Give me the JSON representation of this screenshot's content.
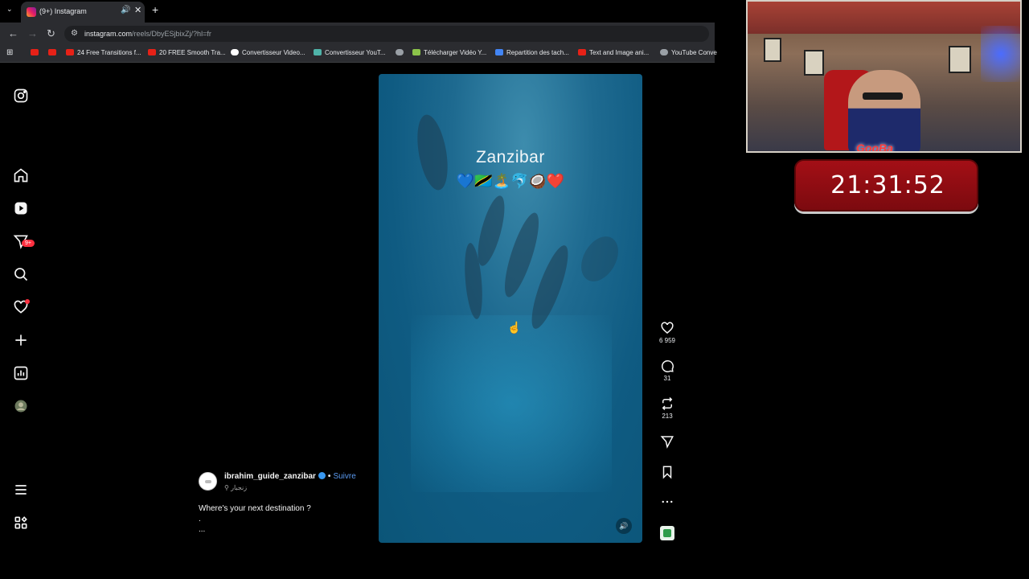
{
  "browser": {
    "tab": {
      "title": "(9+) Instagram"
    },
    "url": {
      "host": "instagram.com",
      "path": "/reels/DbyESjbixZj/?hl=fr"
    },
    "bookmarks": [
      {
        "label": "",
        "icon": "youtube-icon"
      },
      {
        "label": "",
        "icon": "youtube-icon"
      },
      {
        "label": "24 Free Transitions f...",
        "icon": "youtube-icon"
      },
      {
        "label": "20 FREE Smooth Tra...",
        "icon": "youtube-icon"
      },
      {
        "label": "Convertisseur Video...",
        "icon": "google-icon"
      },
      {
        "label": "Convertisseur YouT...",
        "icon": "converter-icon"
      },
      {
        "label": "",
        "icon": "globe-icon"
      },
      {
        "label": "Télécharger Vidéo Y...",
        "icon": "download-icon"
      },
      {
        "label": "Repartition des tach...",
        "icon": "docs-icon"
      },
      {
        "label": "Text and Image ani...",
        "icon": "youtube-icon"
      },
      {
        "label": "YouTube Conve",
        "icon": "globe-icon"
      }
    ]
  },
  "sidebar": {
    "items": [
      {
        "name": "instagram-logo-icon"
      },
      {
        "name": "home-icon"
      },
      {
        "name": "reels-icon"
      },
      {
        "name": "messages-icon",
        "badge": "9+"
      },
      {
        "name": "search-icon"
      },
      {
        "name": "notifications-icon",
        "has_dot": true
      },
      {
        "name": "create-icon"
      },
      {
        "name": "dashboard-icon"
      },
      {
        "name": "profile-avatar"
      },
      {
        "name": "menu-icon"
      },
      {
        "name": "more-apps-icon"
      }
    ]
  },
  "reel": {
    "overlay_title": "Zanzibar",
    "overlay_emoji": "💙🇹🇿🏝️🐬🥥❤️",
    "author": {
      "username": "ibrahim_guide_zanzibar",
      "verified": true,
      "separator": "•",
      "follow_label": "Suivre",
      "location": "زنجبار"
    },
    "caption": {
      "line1": "Where's your next destination ?",
      "line2": ".",
      "line3": "..."
    },
    "actions": {
      "likes": "6 959",
      "comments": "31",
      "reposts": "213"
    }
  },
  "stream": {
    "timer": "21:31:52",
    "streamer_logo": "GooBa"
  },
  "colors": {
    "browser_chrome": "#2b2c30",
    "accent_link": "#5b9bf2",
    "badge_red": "#ff3040",
    "timer_red": "#a30f16"
  }
}
